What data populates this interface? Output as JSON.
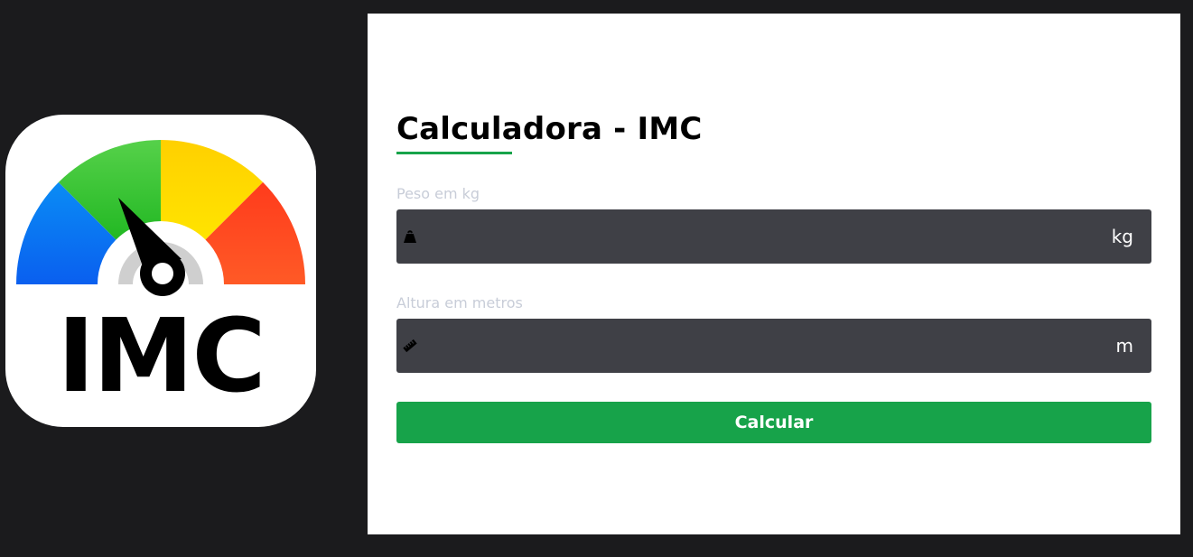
{
  "logo": {
    "text": "IMC",
    "colors": {
      "blue": "#0a6cf0",
      "green": "#3cc43a",
      "yellow": "#ffd400",
      "red": "#ff4a22",
      "needle": "#000000",
      "hub_arc": "#cfcfcf"
    }
  },
  "form": {
    "title": "Calculadora - IMC",
    "accent_color": "#17a34a",
    "weight": {
      "label": "Peso em kg",
      "value": "",
      "placeholder": "",
      "unit": "kg",
      "icon": "weight-icon"
    },
    "height": {
      "label": "Altura em metros",
      "value": "",
      "placeholder": "",
      "unit": "m",
      "icon": "ruler-icon"
    },
    "submit_label": "Calcular"
  }
}
